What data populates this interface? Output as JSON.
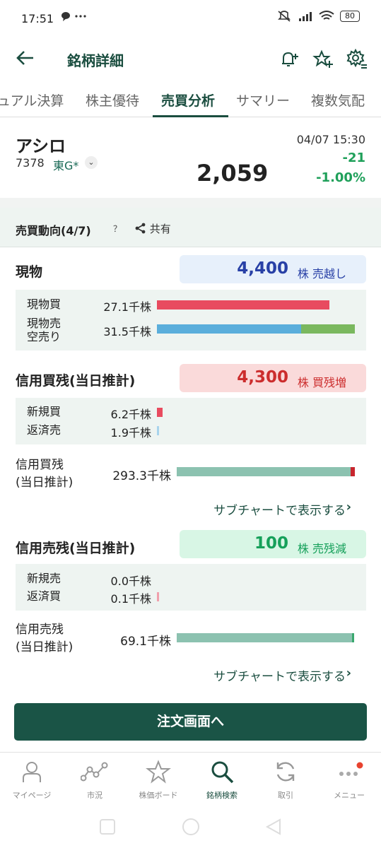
{
  "status_bar": {
    "time": "17:51",
    "extra": "…",
    "battery": "80"
  },
  "header": {
    "title": "銘柄詳細"
  },
  "tabs": [
    "ュアル決算",
    "株主優待",
    "売買分析",
    "サマリー",
    "複数気配"
  ],
  "active_tab": "売買分析",
  "stock": {
    "name": "アシロ",
    "code": "7378",
    "market": "東G*",
    "price": "2,059",
    "datetime": "04/07 15:30",
    "change": "-21",
    "change_pct": "-1.00%"
  },
  "trend": {
    "label": "売買動向(4/7)",
    "help": "？",
    "share": "共有"
  },
  "spot": {
    "title": "現物",
    "badge_value": "4,400",
    "badge_unit": "株 売越し",
    "buy_label": "現物買",
    "buy_value": "27.1千株",
    "buy_fraction": 0.87,
    "sell_label_1": "現物売",
    "sell_label_2": "空売り",
    "sell_value": "31.5千株",
    "sell_spot_fraction": 0.73,
    "sell_short_fraction": 0.27
  },
  "margin_buy": {
    "title": "信用買残(当日推計)",
    "badge_value": "4,300",
    "badge_unit": "株 買残増",
    "new_label": "新規買",
    "new_value": "6.2千株",
    "repay_label": "返済売",
    "repay_value": "1.9千株",
    "total_label_1": "信用買残",
    "total_label_2": "(当日推計)",
    "total_value": "293.3千株",
    "link": "サブチャートで表示する"
  },
  "margin_sell": {
    "title": "信用売残(当日推計)",
    "badge_value": "100",
    "badge_unit": "株 売残減",
    "new_label": "新規売",
    "new_value": "0.0千株",
    "repay_label": "返済買",
    "repay_value": "0.1千株",
    "total_label_1": "信用売残",
    "total_label_2": "(当日推計)",
    "total_value": "69.1千株",
    "link": "サブチャートで表示する"
  },
  "order_button": "注文画面へ",
  "nav": [
    "マイページ",
    "市況",
    "株価ボード",
    "銘柄検索",
    "取引",
    "メニュー"
  ],
  "colors": {
    "accent": "#1a4d3f",
    "buy_red": "#e84b5f",
    "sell_blue": "#5aaedb",
    "short_green": "#7ab85e",
    "balance_teal": "#8cc2b0",
    "up_green": "#1fa05a"
  }
}
